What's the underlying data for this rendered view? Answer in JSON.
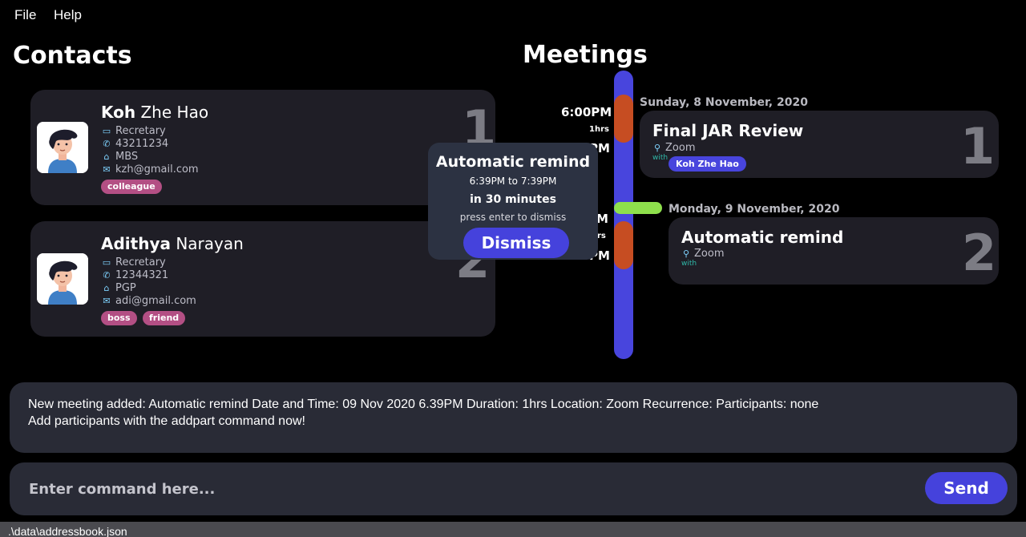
{
  "menu": {
    "file": "File",
    "help": "Help"
  },
  "contacts": {
    "title": "Contacts",
    "items": [
      {
        "first": "Koh",
        "last": "Zhe Hao",
        "role": "Recretary",
        "phone": "43211234",
        "address": "MBS",
        "email": "kzh@gmail.com",
        "tags": [
          "colleague"
        ],
        "index": "1"
      },
      {
        "first": "Adithya",
        "last": "Narayan",
        "role": "Recretary",
        "phone": "12344321",
        "address": "PGP",
        "email": "adi@gmail.com",
        "tags": [
          "boss",
          "friend"
        ],
        "index": "2"
      }
    ]
  },
  "meetings": {
    "title": "Meetings",
    "time_start": "6:00PM",
    "duration": "1hrs",
    "time_partial_1": "PM",
    "time_partial_2": "M",
    "time_partial_3": "rs",
    "time_partial_4": "PM",
    "items": [
      {
        "date": "Sunday, 8 November, 2020",
        "title": "Final JAR Review",
        "location": "Zoom",
        "with": "with",
        "participants": [
          "Koh Zhe Hao"
        ],
        "index": "1"
      },
      {
        "date": "Monday, 9 November, 2020",
        "title": "Automatic remind",
        "location": "Zoom",
        "with": "with",
        "participants": [],
        "index": "2"
      }
    ]
  },
  "popup": {
    "title": "Automatic remind",
    "time": "6:39PM to 7:39PM",
    "countdown": "in 30 minutes",
    "hint": "press enter to dismiss",
    "dismiss": "Dismiss"
  },
  "result": {
    "line1": "New meeting added: Automatic remind Date and Time: 09 Nov 2020 6.39PM Duration: 1hrs Location: Zoom Recurrence:  Participants: none",
    "line2": "Add participants with the addpart command now!"
  },
  "command": {
    "placeholder": "Enter command here...",
    "send": "Send"
  },
  "status": {
    "path": ".\\data\\addressbook.json"
  },
  "colors": {
    "accent": "#4542dc",
    "timeline": "#4845dd",
    "marker": "#c64d22",
    "now": "#8ee04c",
    "tag": "#b34f84"
  }
}
